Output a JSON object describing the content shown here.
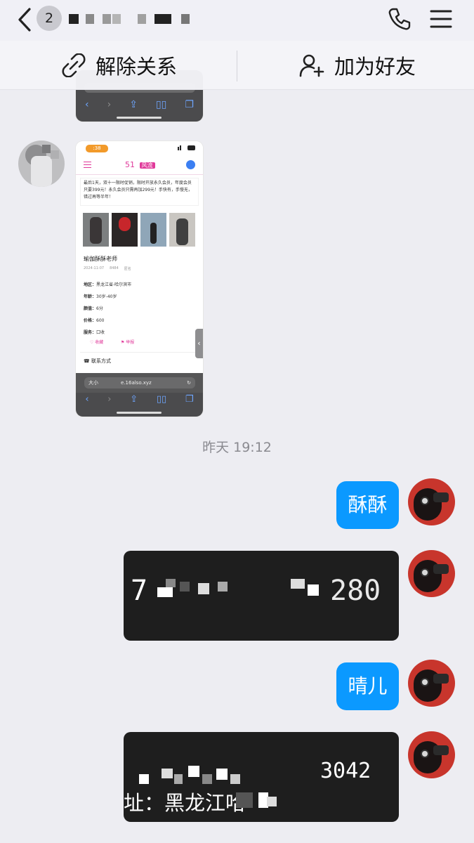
{
  "header": {
    "unread_count": "2",
    "icons": [
      "chevron-left-icon",
      "phone-icon",
      "menu-icon"
    ]
  },
  "actions": {
    "unlink_label": "解除关系",
    "add_friend_label": "加为好友"
  },
  "shot1": {
    "bottom_icons": [
      "back-icon",
      "forward-icon",
      "share-icon",
      "book-icon",
      "tabs-icon"
    ]
  },
  "shot2": {
    "status_time": ":38",
    "logo_num": "51",
    "logo_tag": "风流",
    "notice": "最后1天，双十一限时促销，限时开放永久会员，年度会员只要399元！永久会员只需再加299元！手快有，手慢无，错过再等半年！",
    "profile_title": "瑜伽酥酥老师",
    "meta_date": "2024-11-07",
    "meta_views": "8484",
    "meta_user": "匿名",
    "fields": [
      {
        "label": "地区：",
        "value": "黑龙江省-哈尔滨市"
      },
      {
        "label": "年龄：",
        "value": "30岁-40岁"
      },
      {
        "label": "颜值：",
        "value": "6分"
      },
      {
        "label": "价格：",
        "value": "600"
      },
      {
        "label": "服务：",
        "value": "口收"
      }
    ],
    "favorite": "收藏",
    "report": "举报",
    "contact": "联系方式",
    "url_left": "大小",
    "url": "e.16also.xyz"
  },
  "timestamp": "昨天 19:12",
  "messages": {
    "m1": "酥酥",
    "card1_text": "7",
    "card1_tail": "280",
    "m2": "晴儿",
    "card2_line1": "3042",
    "card2_line2": "址：黑龙江哈"
  },
  "colors": {
    "accent_blue": "#0b99ff",
    "brand_pink": "#e0399a",
    "card_dark": "#1e1e1e",
    "background": "#ededf2"
  }
}
